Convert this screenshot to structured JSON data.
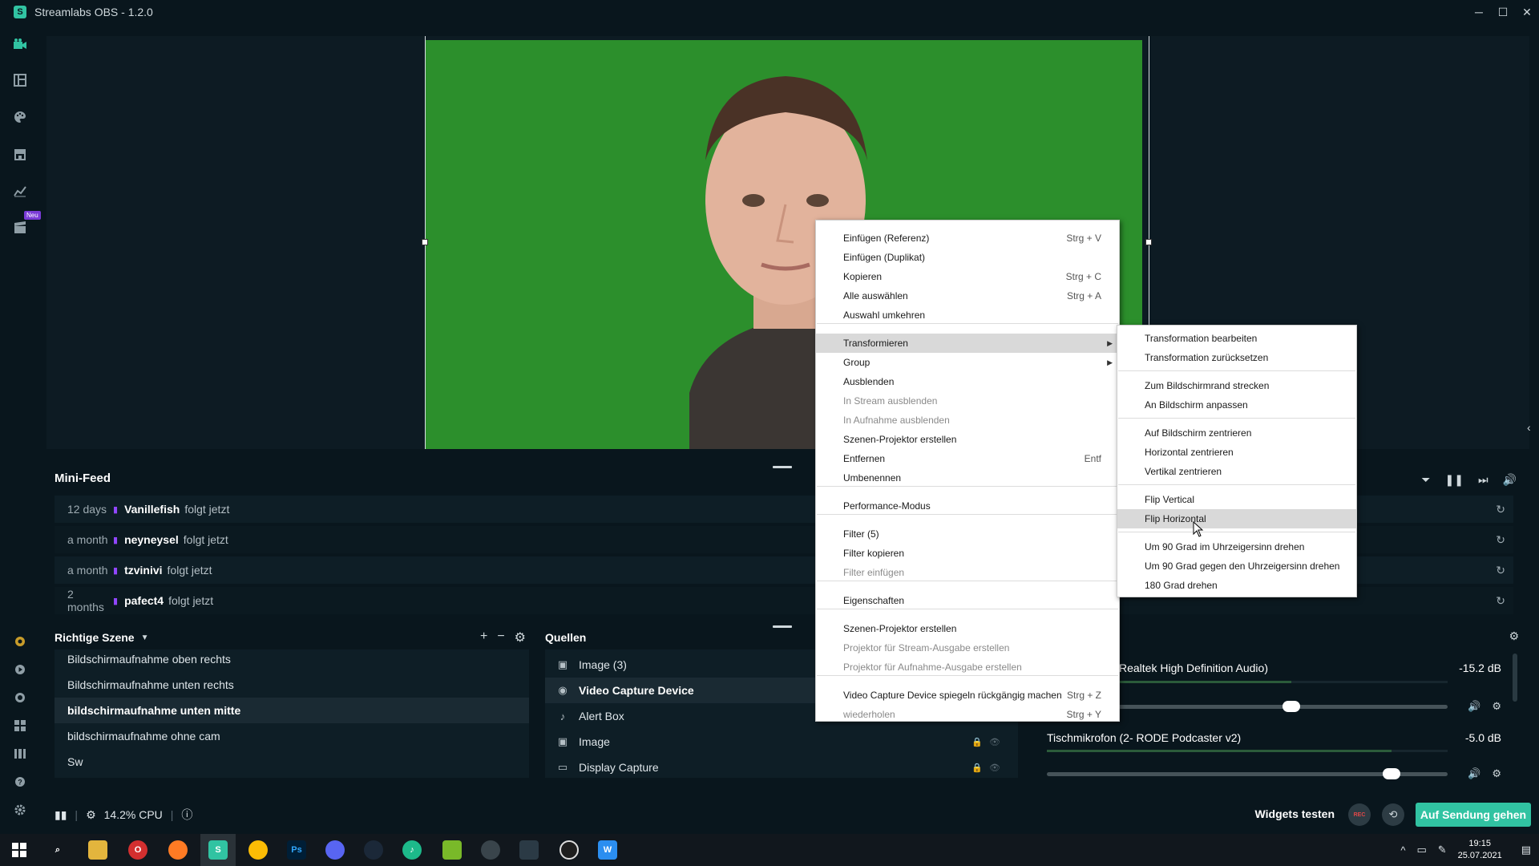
{
  "window": {
    "title": "Streamlabs OBS - 1.2.0",
    "logo_glyph": "S",
    "minimize": "─",
    "maximize": "☐",
    "close": "✕"
  },
  "sidenav": {
    "neu_badge": "Neu"
  },
  "minifeed": {
    "title": "Mini-Feed",
    "rows": [
      {
        "time": "12 days",
        "user": "Vanillefish",
        "action": "folgt jetzt"
      },
      {
        "time": "a month",
        "user": "neyneysel",
        "action": "folgt jetzt"
      },
      {
        "time": "a month",
        "user": "tzvinivi",
        "action": "folgt jetzt"
      },
      {
        "time": "2 months",
        "user": "pafect4",
        "action": "folgt jetzt"
      }
    ]
  },
  "scenes": {
    "title": "Richtige Szene",
    "items": [
      "Bildschirmaufnahme oben rechts",
      "Bildschirmaufnahme unten rechts",
      "bildschirmaufnahme unten mitte",
      "bildschirmaufnahme ohne cam",
      "Sw"
    ],
    "active_index": 2
  },
  "sources": {
    "title": "Quellen",
    "items": [
      {
        "label": "Image (3)",
        "icon": "image-icon"
      },
      {
        "label": "Video Capture Device",
        "icon": "camera-icon"
      },
      {
        "label": "Alert Box",
        "icon": "bell-icon"
      },
      {
        "label": "Image",
        "icon": "image-icon"
      },
      {
        "label": "Display Capture",
        "icon": "monitor-icon"
      }
    ],
    "active_index": 1
  },
  "mixer": {
    "channels": [
      {
        "name": "Realtek High Definition Audio)",
        "db": "-15.2 dB",
        "level": 0.61
      },
      {
        "name": "Tischmikrofon (2- RODE Podcaster v2)",
        "db": "-5.0 dB",
        "level": 0.86
      }
    ]
  },
  "footer": {
    "cpu": "14.2% CPU",
    "widgets": "Widgets testen",
    "rec": "REC",
    "golive": "Auf Sendung gehen"
  },
  "taskbar": {
    "time": "19:15",
    "date": "25.07.2021"
  },
  "context_menu": {
    "items": [
      {
        "label": "Einfügen (Referenz)",
        "shortcut": "Strg + V"
      },
      {
        "label": "Einfügen (Duplikat)",
        "shortcut": ""
      },
      {
        "label": "Kopieren",
        "shortcut": "Strg + C"
      },
      {
        "label": "Alle auswählen",
        "shortcut": "Strg + A"
      },
      {
        "label": "Auswahl umkehren",
        "shortcut": ""
      },
      {
        "label": "Transformieren",
        "shortcut": ""
      },
      {
        "label": "Group",
        "shortcut": ""
      },
      {
        "label": "Ausblenden",
        "shortcut": ""
      },
      {
        "label": "In Stream ausblenden",
        "shortcut": ""
      },
      {
        "label": "In Aufnahme ausblenden",
        "shortcut": ""
      },
      {
        "label": "Szenen-Projektor erstellen",
        "shortcut": ""
      },
      {
        "label": "Entfernen",
        "shortcut": "Entf"
      },
      {
        "label": "Umbenennen",
        "shortcut": ""
      },
      {
        "label": "Performance-Modus",
        "shortcut": ""
      },
      {
        "label": "Filter (5)",
        "shortcut": ""
      },
      {
        "label": "Filter kopieren",
        "shortcut": ""
      },
      {
        "label": "Filter einfügen",
        "shortcut": ""
      },
      {
        "label": "Eigenschaften",
        "shortcut": ""
      },
      {
        "label": "Szenen-Projektor erstellen",
        "shortcut": ""
      },
      {
        "label": "Projektor für Stream-Ausgabe erstellen",
        "shortcut": ""
      },
      {
        "label": "Projektor für Aufnahme-Ausgabe erstellen",
        "shortcut": ""
      },
      {
        "label": "Video Capture Device spiegeln rückgängig machen",
        "shortcut": "Strg + Z"
      },
      {
        "label": "wiederholen",
        "shortcut": "Strg + Y"
      }
    ]
  },
  "submenu": {
    "items": [
      "Transformation bearbeiten",
      "Transformation zurücksetzen",
      "Zum Bildschirmrand strecken",
      "An Bildschirm anpassen",
      "Auf Bildschirm zentrieren",
      "Horizontal zentrieren",
      "Vertikal zentrieren",
      "Flip Vertical",
      "Flip Horizontal",
      "Um 90 Grad im Uhrzeigersinn drehen",
      "Um 90 Grad gegen den Uhrzeigersinn drehen",
      "180 Grad drehen"
    ]
  },
  "colors": {
    "accent": "#31c3a2",
    "background": "#09161d",
    "panel": "#0e1e26",
    "green_screen": "#2c8f2c"
  }
}
